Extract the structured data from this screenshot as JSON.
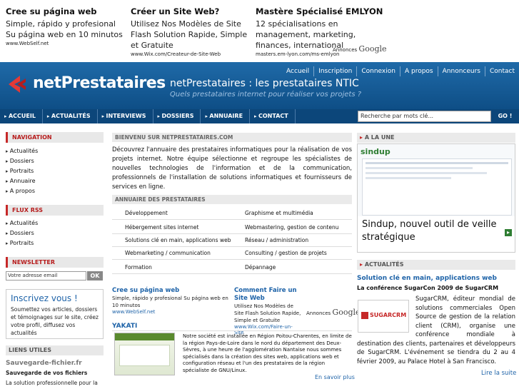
{
  "ads_top": [
    {
      "title": "Cree su página web",
      "desc": "Simple, rápido y profesional Su página web en 10 minutos",
      "url": "www.WebSelf.net"
    },
    {
      "title": "Créer un Site Web?",
      "desc": "Utilisez Nos Modèles de Site Flash Solution Rapide, Simple et Gratuite",
      "url": "www.Wix.com/Createur-de-Site-Web"
    },
    {
      "title": "Mastère Spécialisé EMLYON",
      "desc": "12 spécialisations en management, marketing, finances, international",
      "url": "masters.em-lyon.com/ms-emlyon"
    }
  ],
  "annonces": {
    "label": "Annonces",
    "brand": "Google"
  },
  "header": {
    "logo": "netPrestataires",
    "title": "netPrestataires : les prestataires NTIC",
    "subtitle": "Quels prestataires internet pour réaliser vos projets ?",
    "links": [
      "Accueil",
      "Inscription",
      "Connexion",
      "A propos",
      "Annonceurs",
      "Contact"
    ]
  },
  "nav": [
    "ACCUEIL",
    "ACTUALITÉS",
    "INTERVIEWS",
    "DOSSIERS",
    "ANNUAIRE",
    "CONTACT"
  ],
  "search": {
    "placeholder": "Recherche par mots clé...",
    "button": "GO !"
  },
  "sidebar": {
    "navigation_title": "NAVIGATION",
    "navigation": [
      "Actualités",
      "Dossiers",
      "Portraits",
      "Annuaire",
      "A propos"
    ],
    "rss_title": "FLUX RSS",
    "rss": [
      "Actualités",
      "Dossiers",
      "Portraits"
    ],
    "newsletter_title": "NEWSLETTER",
    "newsletter_placeholder": "Votre adresse email",
    "newsletter_ok": "OK",
    "inscription_title": "Inscrivez vous !",
    "inscription_text": "Soumettez vos articles, dossiers et témoignages sur le site, créez votre profil, diffusez vos actualités",
    "liens_title": "LIENS UTILES",
    "liens": [
      {
        "title": "Sauvegarde-fichier.fr",
        "sub": "Sauvegarde de vos fichiers",
        "desc": "La solution professionnelle pour la"
      }
    ]
  },
  "main": {
    "welcome_title": "BIENVENU SUR NETPRESTATAIRES.COM",
    "welcome_text": "Découvrez l'annuaire des prestataires informatiques pour la réalisation de vos projets internet. Notre équipe sélectionne et regroupe les spécialistes de nouvelles technologies de l'information et de la communication, professionnels de l'installation de solutions informatiques et fournisseurs de services en ligne.",
    "annuaire_title": "ANNUAIRE DES PRESTATAIRES",
    "annuaire": [
      [
        "Développement",
        "Graphisme et multimédia"
      ],
      [
        "Hébergement sites internet",
        "Webmastering, gestion de contenu"
      ],
      [
        "Solutions clé en main, applications web",
        "Réseau / administration"
      ],
      [
        "Webmarketing / communication",
        "Consulting / gestion de projets"
      ],
      [
        "Formation",
        "Dépannage"
      ]
    ],
    "ads": [
      {
        "title": "Cree su página web",
        "desc": "Simple, rápido y profesional Su página web en 10 minutos",
        "url": "www.WebSelf.net"
      },
      {
        "title": "Comment Faire un Site Web",
        "desc": "Utilisez Nos Modèles de Site Flash Solution Rapide, Simple et Gratuite",
        "url": "www.Wix.com/Faire-un-Site"
      }
    ],
    "yakati_title": "YAKATI",
    "yakati_text": "Notre société est installée en Région Poitou-Charentes, en limite de la région Pays-de-Loire dans le nord du département des Deux-Sèvres, à une heure de l'agglomération Nantaise nous sommes spécialisés dans la création des sites web, applications web et configuration réseau et l'un des prestataires de la région spécialiste de GNU/Linux.",
    "en_savoir": "En savoir plus"
  },
  "right": {
    "une_title": "A LA UNE",
    "une_caption": "Sindup, nouvel outil de veille stratégique",
    "une_logo": "sindup",
    "actu_title": "ACTUALITÉS",
    "actu_category": "Solution clé en main, applications web",
    "actu_headline": "La conférence SugarCon 2009 de SugarCRM",
    "actu_logo": "SUGARCRM",
    "actu_text": "SugarCRM, éditeur mondial de solutions commerciales Open Source de gestion de la relation client (CRM), organise une conférence mondiale à destination des clients, partenaires et développeurs de SugarCRM. L'événement se tiendra du 2 au 4 février 2009, au Palace Hotel à San Francisco.",
    "read_more": "Lire la suite"
  },
  "colors": {
    "brand_blue": "#1e63a8",
    "header_dark": "#0e4e86",
    "accent_red": "#c62828"
  }
}
